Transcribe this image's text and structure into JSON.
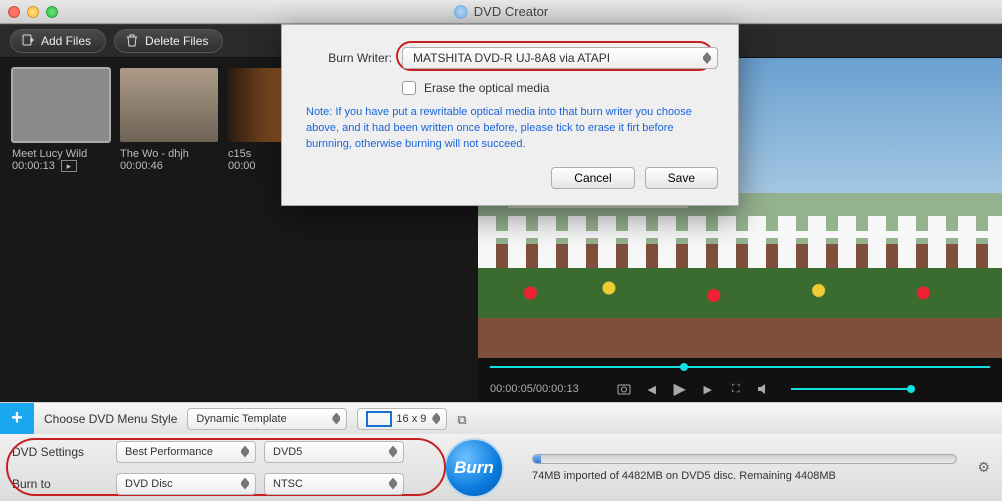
{
  "window": {
    "title": "DVD Creator"
  },
  "toolbar": {
    "add_files": "Add Files",
    "delete_files": "Delete Files"
  },
  "thumbs": [
    {
      "title": "Meet Lucy Wild",
      "time": "00:00:13"
    },
    {
      "title": "The Wo - dhjh",
      "time": "00:00:46"
    },
    {
      "title": "c15s",
      "time": "00:00"
    }
  ],
  "preview": {
    "time": "00:00:05/00:00:13"
  },
  "menurow": {
    "choose": "Choose DVD Menu Style",
    "template": "Dynamic Template",
    "aspect": "16 x 9"
  },
  "settings": {
    "dvd_settings_label": "DVD Settings",
    "burn_to_label": "Burn to",
    "perf": "Best Performance",
    "dvdtype": "DVD5",
    "burn_to": "DVD Disc",
    "tv": "NTSC",
    "burn_label": "Burn",
    "progress_text": "74MB imported of 4482MB on DVD5 disc. Remaining 4408MB"
  },
  "dialog": {
    "burn_writer_label": "Burn Writer:",
    "burn_writer_value": "MATSHITA DVD-R   UJ-8A8 via ATAPI",
    "erase_label": "Erase the optical media",
    "note": "Note: If you have put a rewritable optical media into that burn writer you choose above, and it had been written once before, please tick to erase it firt before burnning, otherwise burning will not succeed.",
    "cancel": "Cancel",
    "save": "Save"
  }
}
